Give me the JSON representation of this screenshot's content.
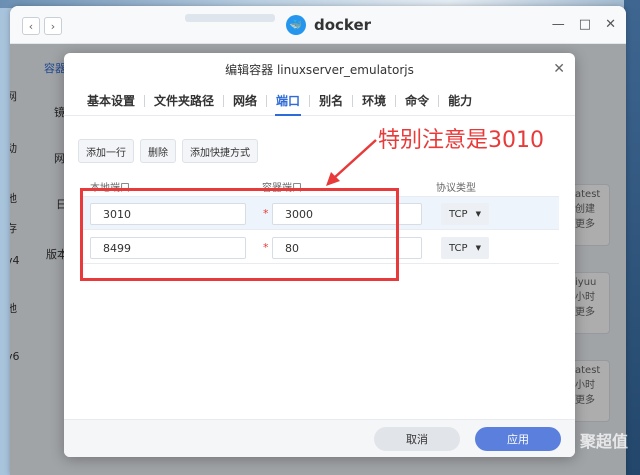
{
  "window": {
    "title": "docker",
    "back_icon": "‹",
    "forward_icon": "›",
    "min_icon": "—",
    "max_icon": "□",
    "close_icon": "✕"
  },
  "background": {
    "side_labels": [
      "容器",
      "网",
      "镜",
      "动",
      "网",
      "地",
      "日",
      "存",
      "v4",
      "版本",
      "地",
      "v6"
    ],
    "card_texts": [
      "atest",
      "创建",
      "更多",
      "iyuu",
      "小时",
      "更多",
      "atest",
      "小时",
      "更多"
    ]
  },
  "modal": {
    "title": "编辑容器 linuxserver_emulatorjs",
    "close_icon": "✕",
    "tabs": [
      {
        "label": "基本设置"
      },
      {
        "label": "文件夹路径"
      },
      {
        "label": "网络"
      },
      {
        "label": "端口",
        "active": true
      },
      {
        "label": "别名"
      },
      {
        "label": "环境"
      },
      {
        "label": "命令"
      },
      {
        "label": "能力"
      }
    ],
    "toolbar": {
      "add_row": "添加一行",
      "delete": "删除",
      "add_shortcut": "添加快捷方式"
    },
    "table": {
      "headers": [
        "本地端口",
        "容器端口",
        "协议类型"
      ],
      "rows": [
        {
          "local": "3010",
          "container": "3000",
          "protocol": "TCP"
        },
        {
          "local": "8499",
          "container": "80",
          "protocol": "TCP"
        }
      ],
      "required_mark": "*",
      "dropdown_icon": "▼"
    },
    "footer": {
      "cancel": "取消",
      "apply": "应用"
    }
  },
  "annotation": {
    "text": "特别注意是3010",
    "color": "#e83a3a"
  },
  "watermark": "聚超值",
  "colors": {
    "accent": "#2f6bd6",
    "apply_button": "#5b7fdc",
    "docker_blue": "#2496ed"
  }
}
